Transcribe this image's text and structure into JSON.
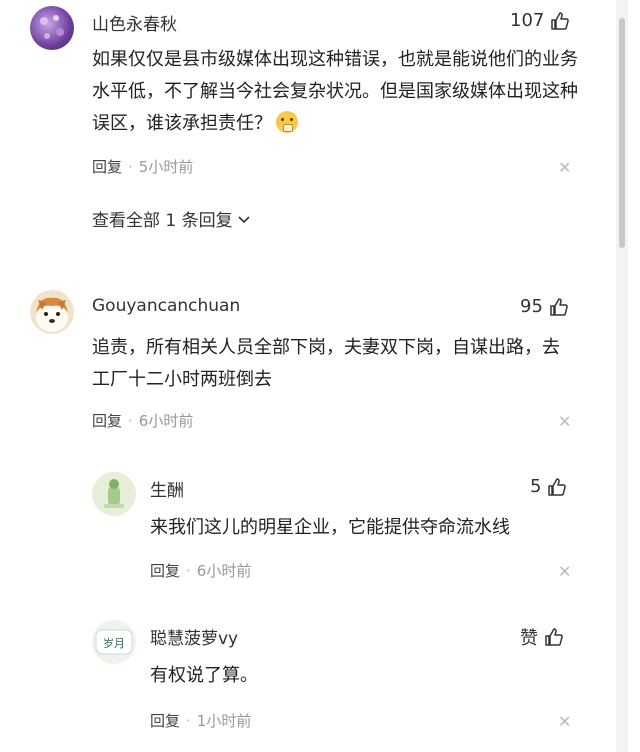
{
  "comments": [
    {
      "user": "山色永春秋",
      "likes": "107",
      "text": "如果仅仅是县市级媒体出现这种错误，也就是能说他们的业务水平低，不了解当今社会复杂状况。但是国家级媒体出现这种误区，谁该承担责任？",
      "reply_label": "回复",
      "time": "5小时前",
      "view_all": "查看全部 1 条回复"
    },
    {
      "user": "Gouyancanchuan",
      "likes": "95",
      "text": "追责，所有相关人员全部下岗，夫妻双下岗，自谋出路，去工厂十二小时两班倒去",
      "reply_label": "回复",
      "time": "6小时前",
      "replies": [
        {
          "user": "生酬",
          "likes": "5",
          "text": "来我们这儿的明星企业，它能提供夺命流水线",
          "reply_label": "回复",
          "time": "6小时前"
        },
        {
          "user": "聪慧菠萝vy",
          "likes": "赞",
          "text": "有权说了算。",
          "reply_label": "回复",
          "time": "1小时前",
          "avatar_text": "岁月"
        }
      ]
    }
  ],
  "colors": {
    "text": "#222222",
    "meta": "#999999",
    "avatar1": "#7b4aa8",
    "avatar3": "#e7f0d8"
  },
  "icons": {
    "like": "thumbs-up-icon",
    "close": "close-icon",
    "expand": "chevron-down-icon"
  }
}
